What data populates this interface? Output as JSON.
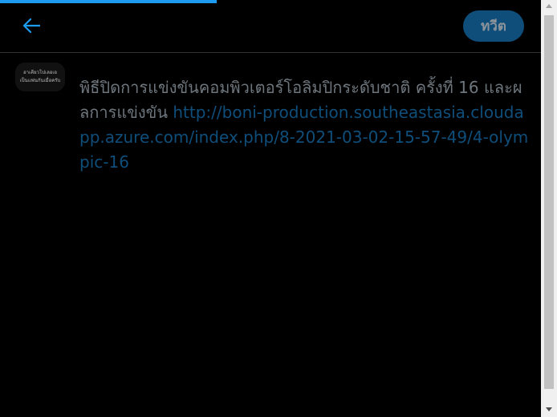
{
  "progress": {
    "percent": 40,
    "color": "#1d9bf0"
  },
  "header": {
    "back_icon": "arrow-left-icon",
    "tweet_button_label": "ทวีต"
  },
  "avatar": {
    "line1": "ฮาเคียวโปเลอเอ",
    "line2": "เป็นแฟนกันเมื่อครับ"
  },
  "tweet": {
    "text": "พิธีปิดการแข่งขันคอมพิวเตอร์โอลิมปิกระดับชาติ ครั้งที่ 16 และผลการแข่งขัน ",
    "link": "http://boni-production.southeastasia.cloudapp.azure.com/index.php/8-2021-03-02-15-57-49/4-olympic-16"
  },
  "colors": {
    "background": "#000000",
    "accent": "#1d9bf0",
    "button_bg": "#0f4e7a",
    "link": "#0f4e7a",
    "text": "#6e767d"
  }
}
